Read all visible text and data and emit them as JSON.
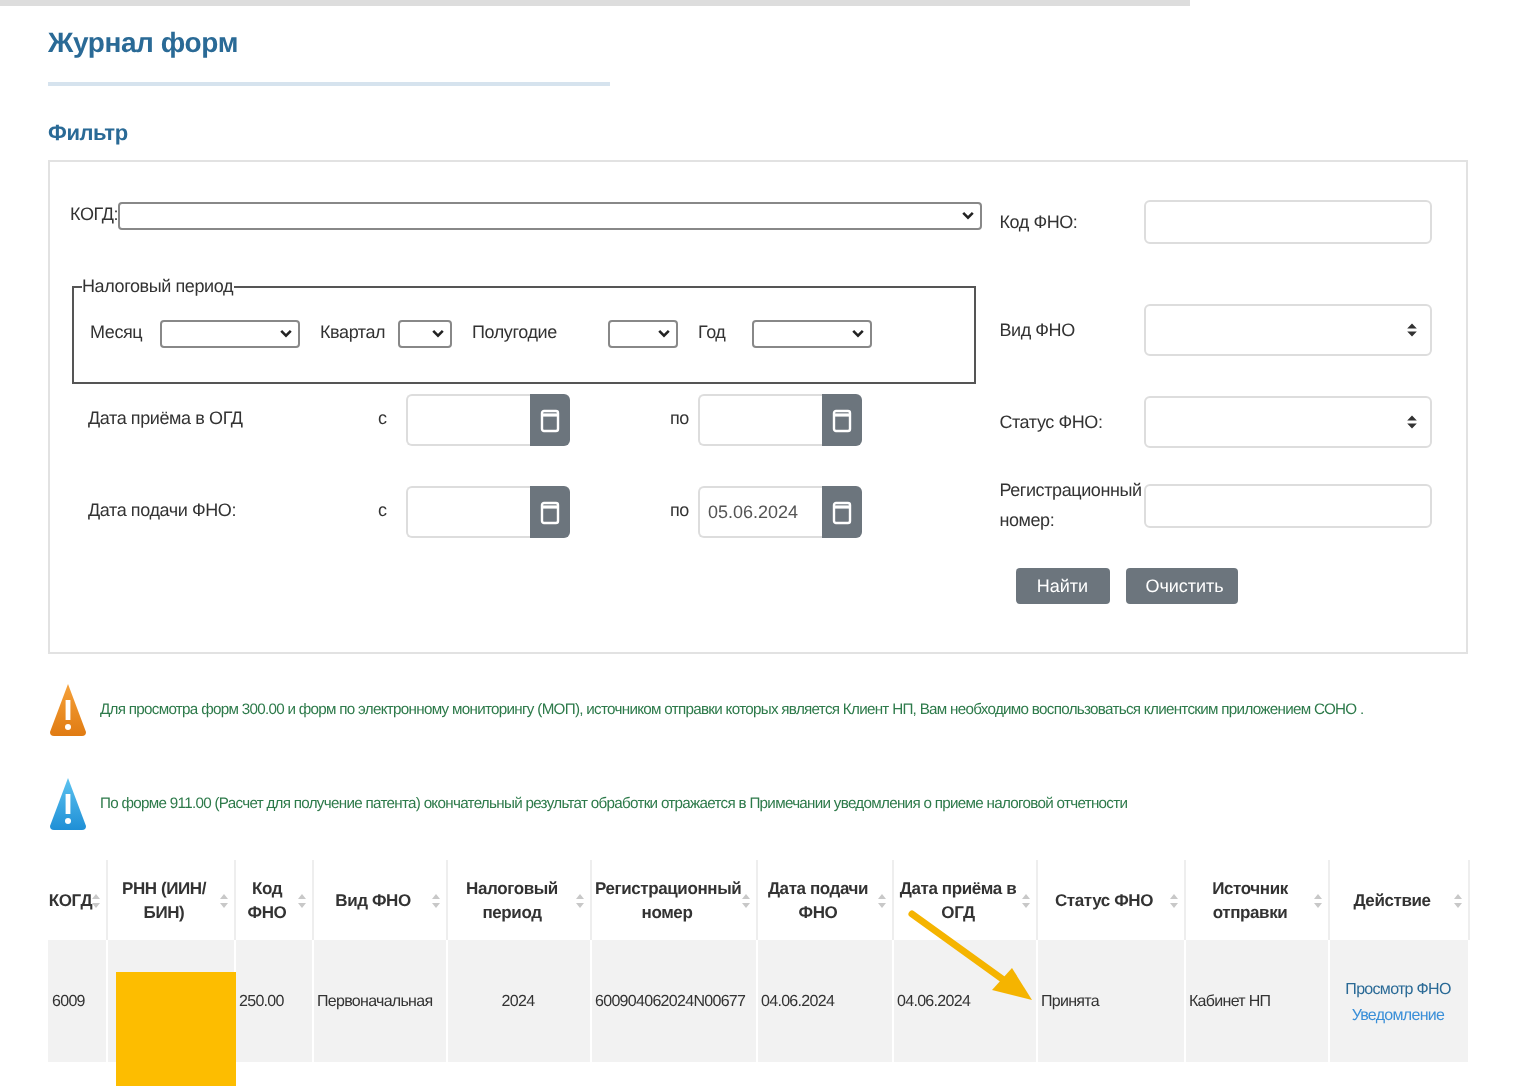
{
  "page_title": "Журнал форм",
  "filter": {
    "title": "Фильтр",
    "kogd": {
      "label": "КОГД:"
    },
    "tax_period": {
      "legend": "Налоговый период",
      "fields": [
        {
          "label": "Месяц"
        },
        {
          "label": "Квартал"
        },
        {
          "label": "Полугодие"
        },
        {
          "label": "Год"
        }
      ]
    },
    "date_rows": [
      {
        "label": "Дата приёма в ОГД",
        "from_label": "с",
        "to_label": "по"
      },
      {
        "label": "Дата подачи ФНО:",
        "from_label": "с",
        "to_label": "по",
        "to_value": "05.06.2024"
      }
    ],
    "right_fields": [
      {
        "kind": "input",
        "label": "Код ФНО:"
      },
      {
        "kind": "select",
        "label": "Вид ФНО"
      },
      {
        "kind": "select",
        "label": "Статус ФНО:"
      },
      {
        "kind": "input",
        "label": "Регистрационный номер:"
      }
    ],
    "buttons": [
      "Найти",
      "Очистить"
    ]
  },
  "notices": [
    {
      "kind": "warning",
      "text": "Для просмотра форм 300.00 и форм по электронному мониторингу (МОП), источником отправки которых является Клиент НП, Вам необходимо воспользоваться клиентским приложением СОНО ."
    },
    {
      "kind": "info",
      "text": "По форме 911.00 (Расчет для получение патента) окончательный результат обработки отражается в Примечании уведомления о приеме налоговой отчетности"
    }
  ],
  "table": {
    "columns": [
      "КОГД",
      "РНН (ИИН/ БИН)",
      "Код ФНО",
      "Вид ФНО",
      "Налоговый период",
      "Регистрационный номер",
      "Дата подачи ФНО",
      "Дата приёма в ОГД",
      "Статус ФНО",
      "Источник отправки",
      "Действие"
    ],
    "rows": [
      {
        "cells": [
          {
            "text": "6009"
          },
          {
            "redacted": true
          },
          {
            "text": "250.00"
          },
          {
            "text": "Первоначальная"
          },
          {
            "text": "2024"
          },
          {
            "text": "600904062024N00677"
          },
          {
            "text": "04.06.2024"
          },
          {
            "text": "04.06.2024"
          },
          {
            "text": "Принята"
          },
          {
            "text": "Кабинет НП"
          }
        ],
        "actions": [
          {
            "text": "Просмотр ФНО",
            "visited": true
          },
          {
            "text": "Уведомление",
            "visited": false
          }
        ]
      }
    ]
  }
}
